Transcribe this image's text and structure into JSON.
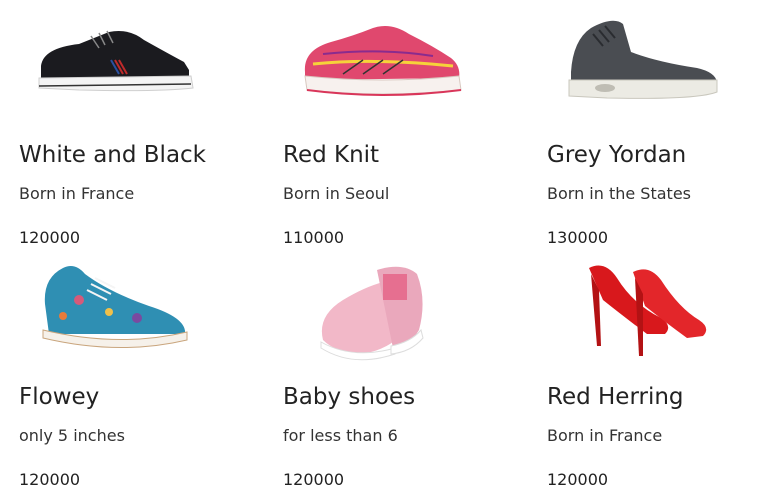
{
  "products": [
    {
      "name": "White and Black",
      "description": "Born in France",
      "price": "120000",
      "image_icon": "black-sneaker-icon"
    },
    {
      "name": "Red Knit",
      "description": "Born in Seoul",
      "price": "110000",
      "image_icon": "red-running-shoe-icon"
    },
    {
      "name": "Grey Yordan",
      "description": "Born in the States",
      "price": "130000",
      "image_icon": "grey-high-top-sneaker-icon"
    },
    {
      "name": "Flowey",
      "description": "only 5 inches",
      "price": "120000",
      "image_icon": "floral-oxford-shoe-icon"
    },
    {
      "name": "Baby shoes",
      "description": "for less than 6",
      "price": "120000",
      "image_icon": "pink-slip-on-shoe-icon"
    },
    {
      "name": "Red Herring",
      "description": "Born in France",
      "price": "120000",
      "image_icon": "red-high-heels-icon"
    }
  ],
  "colors": {
    "text": "#222222",
    "background": "#ffffff"
  }
}
